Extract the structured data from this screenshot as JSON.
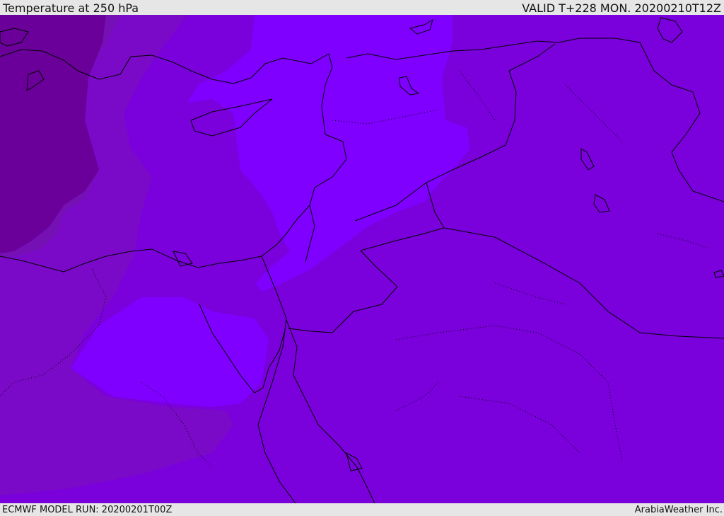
{
  "header": {
    "title": "Temperature at 250 hPa",
    "valid_time": "VALID T+228 MON. 20200210T12Z"
  },
  "footer": {
    "model_run": "ECMWF MODEL RUN: 20200201T00Z",
    "credit": "ArabiaWeather Inc."
  },
  "map": {
    "variable": "temperature",
    "pressure_level_hPa": 250,
    "colors": {
      "background_field": "#7a00dc",
      "warm_band": "#7f00ff",
      "cool_band": "#7a0ac8",
      "coldest_core": "#6a0099",
      "mid_cold": "#7410b4",
      "coastline": "#000000",
      "bar": "#e6e6e6"
    }
  }
}
